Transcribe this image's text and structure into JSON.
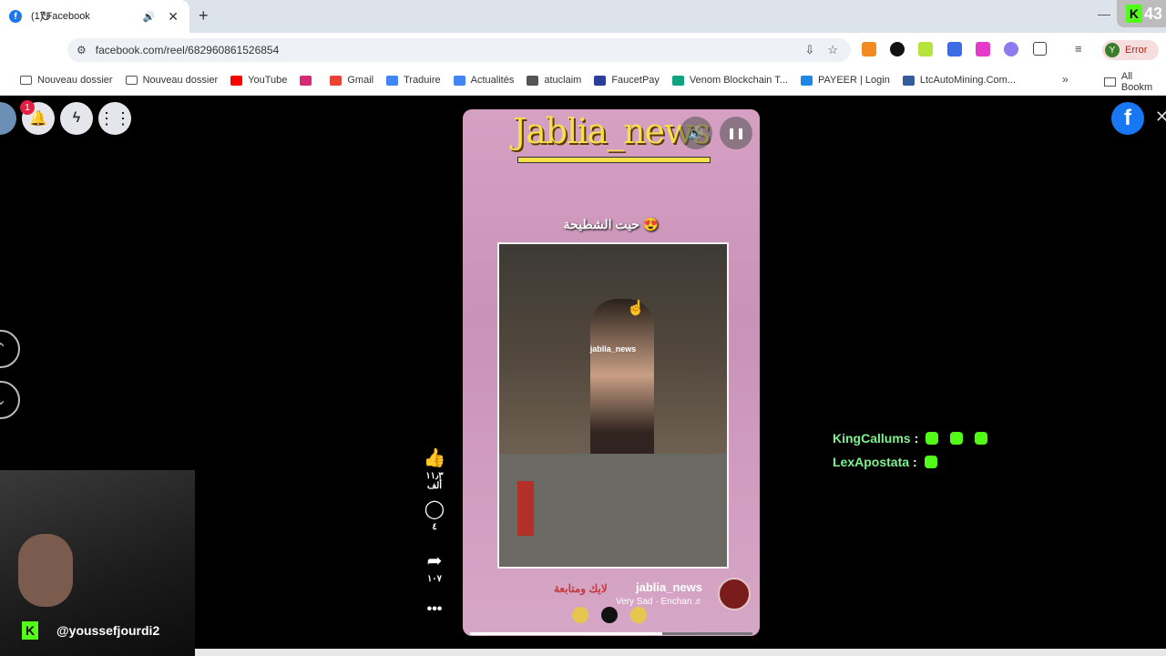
{
  "browser": {
    "tab_title": "(1) Facebook",
    "tab_favicon": "f",
    "tab_audio_icon": "speaker-icon",
    "new_tab": "+",
    "url": "facebook.com/reel/682960861526854",
    "profile_initial": "Y",
    "profile_status": "Error",
    "kick_counter": "43",
    "bookmarks": [
      {
        "label": "Nouveau dossier",
        "icon": "folder-icon",
        "color": "#555555"
      },
      {
        "label": "Nouveau dossier",
        "icon": "folder-icon",
        "color": "#555555"
      },
      {
        "label": "YouTube",
        "icon": "youtube-icon",
        "color": "#ff0000"
      },
      {
        "label": "",
        "icon": "instagram-icon",
        "color": "#d62976"
      },
      {
        "label": "Gmail",
        "icon": "gmail-icon",
        "color": "#ea4335"
      },
      {
        "label": "Traduire",
        "icon": "translate-icon",
        "color": "#4285f4"
      },
      {
        "label": "Actualités",
        "icon": "news-icon",
        "color": "#4285f4"
      },
      {
        "label": "atuclaim",
        "icon": "globe-icon",
        "color": "#555555"
      },
      {
        "label": "FaucetPay",
        "icon": "faucetpay-icon",
        "color": "#2c3e99"
      },
      {
        "label": "Venom Blockchain T...",
        "icon": "venom-icon",
        "color": "#10a37f"
      },
      {
        "label": "PAYEER | Login",
        "icon": "payeer-icon",
        "color": "#1e88e5"
      },
      {
        "label": "LtcAutoMining.Com...",
        "icon": "ltc-icon",
        "color": "#345d9d"
      }
    ],
    "all_bookmarks": "All Bookm"
  },
  "reel": {
    "title": "Jablia_news",
    "caption": "حيت الشطيحة 😍",
    "watermark": "jablia_news",
    "username": "jablia_news",
    "follow_text": "لايك ومتابعة",
    "music": "Very Sad · Enchan ♬",
    "likes": "١١٫٣ ألف",
    "comments": "٤",
    "shares": "١٠٧",
    "progress": 0.68
  },
  "left_nav": {
    "notification_count": "1"
  },
  "chat": [
    {
      "user": "KingCallums",
      "emotes": 3
    },
    {
      "user": "LexApostata",
      "emotes": 1
    }
  ],
  "webcam": {
    "handle": "@youssefjourdi2"
  },
  "colors": {
    "facebook_blue": "#1877f2",
    "kick_green": "#53fc18",
    "reel_title_yellow": "#f6e04a"
  }
}
